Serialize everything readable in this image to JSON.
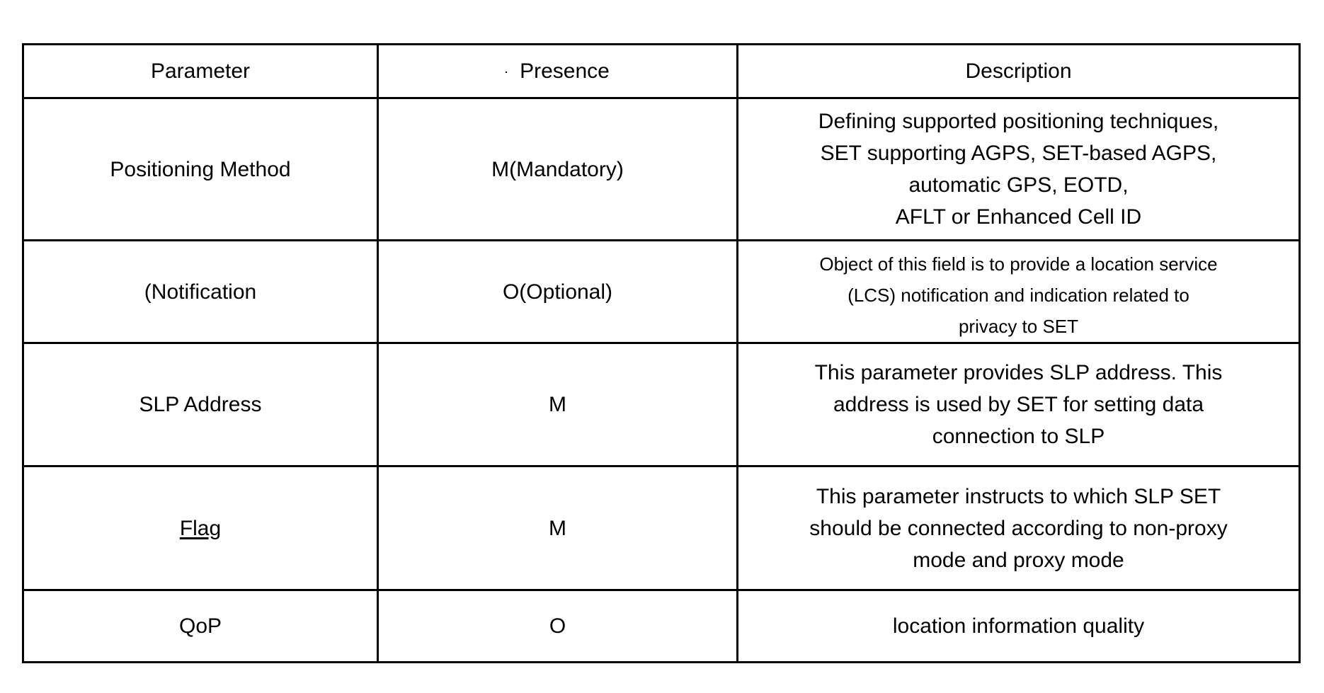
{
  "table": {
    "headers": {
      "parameter": "Parameter",
      "presence": "Presence",
      "description": "Description"
    },
    "rows": [
      {
        "parameter": "Positioning Method",
        "presence": "M(Mandatory)",
        "description_lines": [
          "Defining supported positioning techniques,",
          "SET supporting AGPS, SET-based AGPS,",
          "automatic GPS, EOTD,",
          "AFLT or Enhanced Cell ID"
        ]
      },
      {
        "parameter": "(Notification",
        "presence": "O(Optional)",
        "description_lines": [
          "Object of this field is to provide a location service",
          "(LCS) notification and indication related to",
          "privacy to SET"
        ]
      },
      {
        "parameter": "SLP Address",
        "presence": "M",
        "description_lines": [
          "This parameter provides SLP address. This",
          "address is used by SET for setting data",
          "connection to SLP"
        ]
      },
      {
        "parameter": "Flag",
        "parameter_underlined": true,
        "presence": "M",
        "description_lines": [
          "This parameter instructs to which SLP SET",
          "should be connected according to non-proxy",
          "mode and proxy mode"
        ]
      },
      {
        "parameter": "QoP",
        "presence": "O",
        "description_lines": [
          "location information quality"
        ]
      }
    ]
  }
}
